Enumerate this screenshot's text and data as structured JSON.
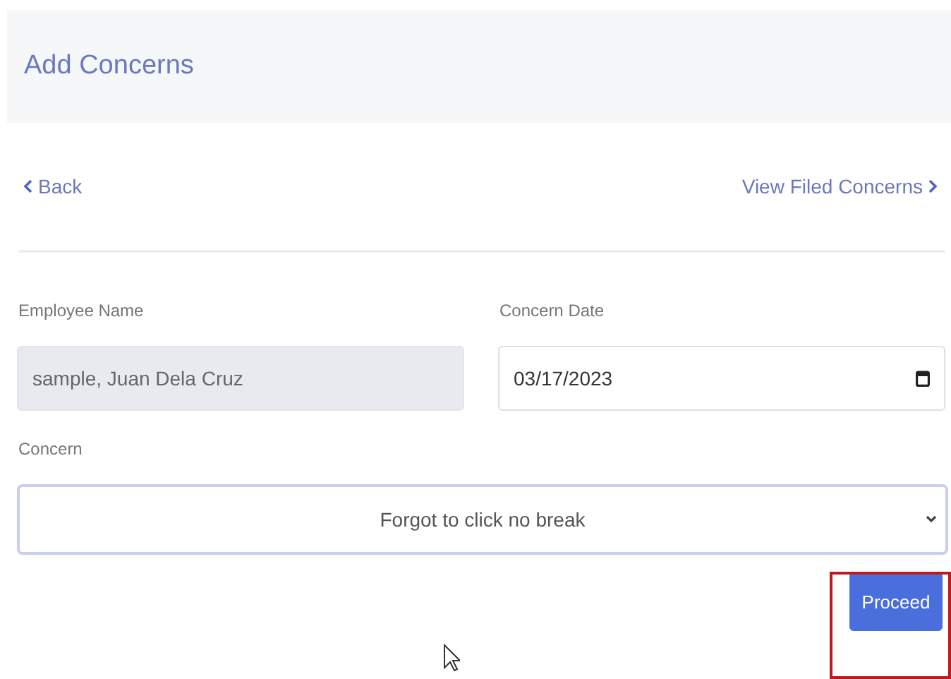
{
  "header": {
    "title": "Add Concerns"
  },
  "nav": {
    "back": "Back",
    "view": "View Filed Concerns"
  },
  "fields": [
    {
      "label": "Employee Name",
      "value": "sample, Juan Dela Cruz",
      "kind": "readonly"
    },
    {
      "label": "Concern Date",
      "value": "03/17/2023",
      "kind": "date"
    }
  ],
  "concern": {
    "label": "Concern",
    "value": "Forgot to click no break"
  },
  "buttons": [
    "Proceed"
  ]
}
